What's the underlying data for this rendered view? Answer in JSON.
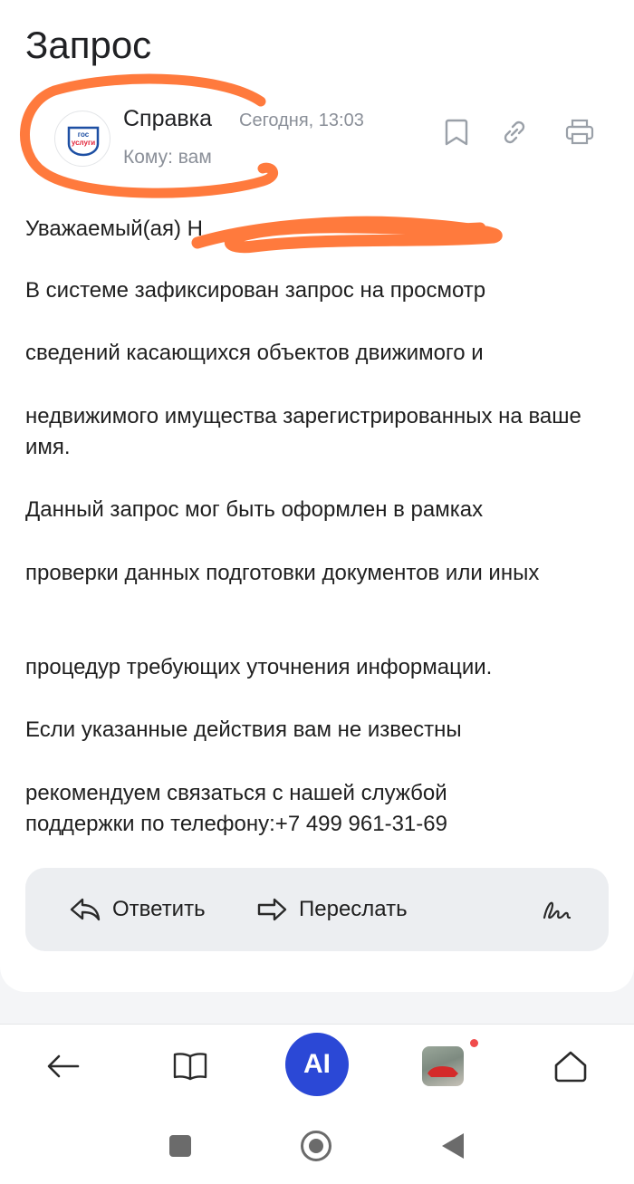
{
  "header": {
    "title": "Запрос"
  },
  "message": {
    "sender": "Справка",
    "date": "Сегодня, 13:03",
    "to": "Кому: вам",
    "avatar_logo_text": "гос услуги",
    "paragraphs": [
      "Уважаемый(ая) Н",
      "В системе зафиксирован запрос на просмотр",
      "сведений касающихся объектов движимого и",
      "недвижимого имущества зарегистрированных на ваше имя.",
      "Данный запрос мог быть оформлен в рамках",
      "проверки данных подготовки документов или иных",
      "процедур требующих уточнения информации.",
      "Если указанные действия вам не известны",
      "рекомендуем связаться с нашей службой поддержки по телефону:+7 499 961-31-69"
    ]
  },
  "actions": {
    "reply": "Ответить",
    "forward": "Переслать"
  },
  "navbar": {
    "ai_label": "AI"
  },
  "icons": [
    "bookmark-icon",
    "link-icon",
    "print-icon",
    "reply-icon",
    "forward-icon",
    "signature-icon",
    "back-arrow-icon",
    "book-icon",
    "ai-icon",
    "home-icon"
  ],
  "colors": {
    "accent": "#2b48d6",
    "scribble": "#ff7a3d",
    "badge": "#f04b4b"
  }
}
